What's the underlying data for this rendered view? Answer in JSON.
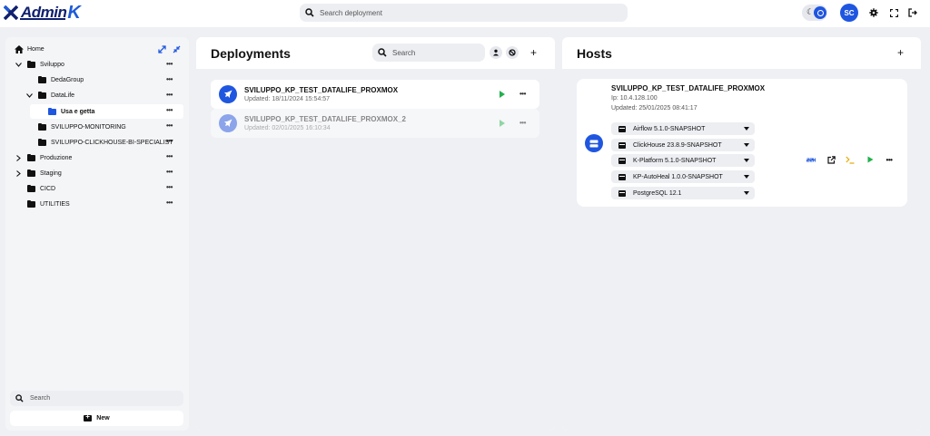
{
  "app": {
    "logo_text": "Admin",
    "logo_suffix": "K"
  },
  "header": {
    "search_placeholder": "Search deployment",
    "avatar_initials": "SC",
    "colors": {
      "accent": "#1f56e0"
    }
  },
  "sidebar": {
    "tree": [
      {
        "label": "Home",
        "icon": "home-icon"
      },
      {
        "label": "Sviluppo",
        "icon": "folder-icon",
        "expanded": true
      },
      {
        "label": "DedaGroup",
        "icon": "folder-icon"
      },
      {
        "label": "DataLife",
        "icon": "folder-icon",
        "expanded": true
      },
      {
        "label": "Usa e getta",
        "icon": "folder-icon",
        "selected": true
      },
      {
        "label": "SVILUPPO-MONITORING",
        "icon": "folder-icon"
      },
      {
        "label": "SVILUPPO-CLICKHOUSE-BI-SPECIALIST",
        "icon": "folder-icon"
      },
      {
        "label": "Produzione",
        "icon": "folder-icon",
        "expanded": false
      },
      {
        "label": "Staging",
        "icon": "folder-icon",
        "expanded": false
      },
      {
        "label": "CICD",
        "icon": "folder-icon"
      },
      {
        "label": "UTILITIES",
        "icon": "folder-icon"
      }
    ],
    "search_placeholder": "Search",
    "new_label": "New"
  },
  "deployments": {
    "title": "Deployments",
    "search_placeholder": "Search",
    "items": [
      {
        "name": "SVILUPPO_KP_TEST_DATALIFE_PROXMOX",
        "updated": "Updated: 18/11/2024 15:54:57"
      },
      {
        "name": "SVILUPPO_KP_TEST_DATALIFE_PROXMOX_2",
        "updated": "Updated: 02/01/2025 16:10:34"
      }
    ]
  },
  "hosts": {
    "title": "Hosts",
    "host": {
      "name": "SVILUPPO_KP_TEST_DATALIFE_PROXMOX",
      "ip": "Ip: 10.4.128.100",
      "updated": "Updated: 25/01/2025 08:41:17",
      "services": [
        "Airflow 5.1.0-SNAPSHOT",
        "ClickHouse 23.8.9-SNAPSHOT",
        "K-Platform 5.1.0-SNAPSHOT",
        "KP-AutoHeal 1.0.0-SNAPSHOT",
        "PostgreSQL 12.1"
      ],
      "actions": [
        "ssh-icon",
        "open-external-icon",
        "terminal-icon",
        "play-icon",
        "more-icon"
      ]
    }
  }
}
